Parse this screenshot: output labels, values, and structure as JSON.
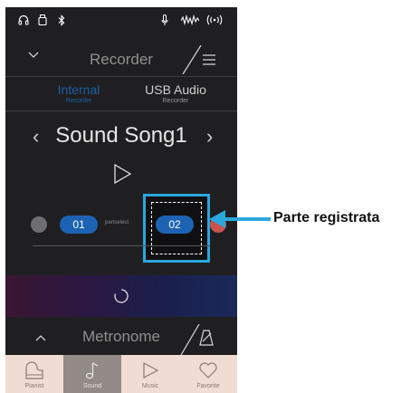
{
  "status_bar": {
    "icons": [
      "headphones-icon",
      "usb-icon",
      "bluetooth-icon",
      "mic-icon",
      "waveform-icon",
      "wireless-icon"
    ]
  },
  "header": {
    "title": "Recorder",
    "icons": [
      "chevron-down-icon",
      "menu-icon"
    ]
  },
  "recorder_tabs": [
    {
      "label": "Internal",
      "sublabel": "Recorder",
      "active": true
    },
    {
      "label": "USB Audio",
      "sublabel": "Recorder",
      "active": false
    }
  ],
  "song": {
    "name": "Sound Song1"
  },
  "parts": {
    "part1": "01",
    "separator": "partselect",
    "part2": "02"
  },
  "metronome": {
    "title": "Metronome"
  },
  "bottom_nav": [
    {
      "label": "Pianist",
      "icon": "piano-icon",
      "active": false
    },
    {
      "label": "Sound",
      "icon": "music-note-icon",
      "active": true
    },
    {
      "label": "Music",
      "icon": "play-icon",
      "active": false
    },
    {
      "label": "Favorite",
      "icon": "heart-icon",
      "active": false
    }
  ],
  "annotation": {
    "label": "Parte registrata"
  },
  "colors": {
    "background": "#1f1f21",
    "accent_blue": "#1d63b3",
    "highlight": "#2aa7dc",
    "nav_background": "#f0dcd3"
  }
}
